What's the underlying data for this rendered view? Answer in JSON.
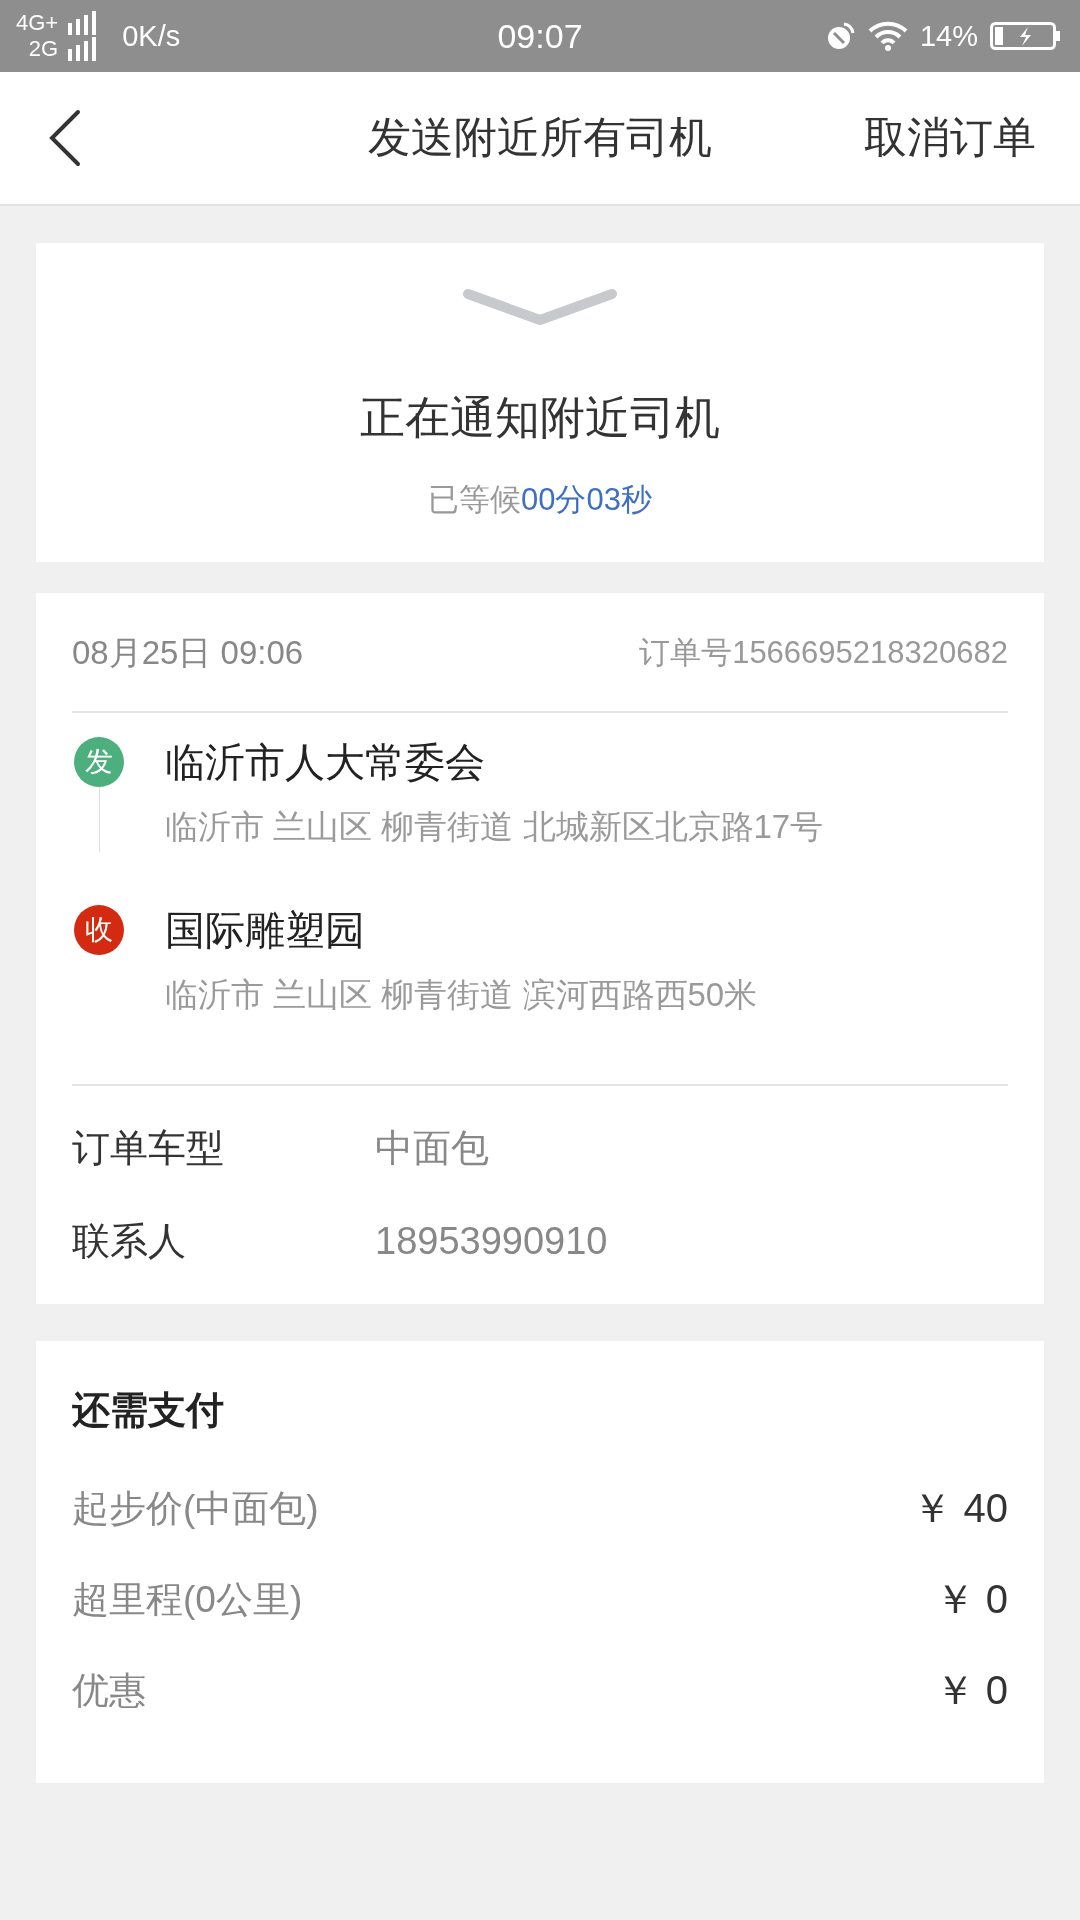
{
  "status_bar": {
    "network_top": "4G+",
    "network_bottom": "2G",
    "speed": "0K/s",
    "time": "09:07",
    "battery": "14%"
  },
  "nav": {
    "title": "发送附近所有司机",
    "action": "取消订单"
  },
  "waiting": {
    "title": "正在通知附近司机",
    "label": "已等候",
    "elapsed": "00分03秒"
  },
  "order": {
    "date": "08月25日 09:06",
    "number": "订单号1566695218320682",
    "stops": [
      {
        "kind": "pickup",
        "badge": "发",
        "color": "#4caf7d",
        "name": "临沂市人大常委会",
        "address": "临沂市 兰山区 柳青街道 北城新区北京路17号"
      },
      {
        "kind": "dropoff",
        "badge": "收",
        "color": "#d42a12",
        "name": "国际雕塑园",
        "address": "临沂市 兰山区 柳青街道 滨河西路西50米"
      }
    ],
    "details": [
      {
        "label": "订单车型",
        "value": "中面包"
      },
      {
        "label": "联系人",
        "value": "18953990910"
      }
    ]
  },
  "payment": {
    "title": "还需支付",
    "items": [
      {
        "label": "起步价(中面包)",
        "amount": "￥ 40"
      },
      {
        "label": "超里程(0公里)",
        "amount": "￥ 0"
      },
      {
        "label": "优惠",
        "amount": "￥ 0"
      }
    ]
  }
}
